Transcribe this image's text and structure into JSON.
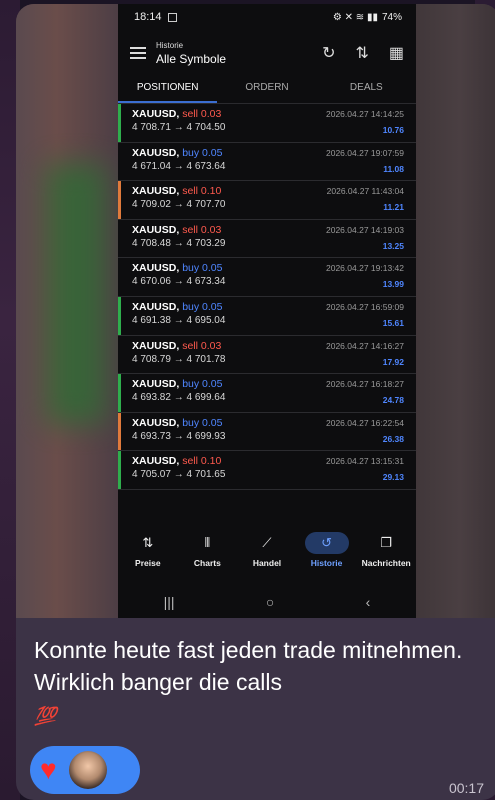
{
  "status": {
    "time": "18:14",
    "battery": "74%",
    "icons": "⚙ ✕ ≋ ▮▮"
  },
  "appbar": {
    "small_title": "Historie",
    "title": "Alle Symbole",
    "icon1": "↻",
    "icon2": "⇅",
    "icon3": "▦"
  },
  "tabs": [
    {
      "label": "POSITIONEN"
    },
    {
      "label": "ORDERN"
    },
    {
      "label": "DEALS"
    }
  ],
  "rows": [
    {
      "symbol": "XAUUSD,",
      "side": "sell 0.03",
      "side_type": "sell",
      "prices": "4 708.71 → 4 704.50",
      "time": "2026.04.27 14:14:25",
      "profit": "10.76",
      "bar_color": "#2fae4d"
    },
    {
      "symbol": "XAUUSD,",
      "side": "buy 0.05",
      "side_type": "buy",
      "prices": "4 671.04 → 4 673.64",
      "time": "2026.04.27 19:07:59",
      "profit": "11.08",
      "bar_color": ""
    },
    {
      "symbol": "XAUUSD,",
      "side": "sell 0.10",
      "side_type": "sell",
      "prices": "4 709.02 → 4 707.70",
      "time": "2026.04.27 11:43:04",
      "profit": "11.21",
      "bar_color": "#e07a3c"
    },
    {
      "symbol": "XAUUSD,",
      "side": "sell 0.03",
      "side_type": "sell",
      "prices": "4 708.48 → 4 703.29",
      "time": "2026.04.27 14:19:03",
      "profit": "13.25",
      "bar_color": ""
    },
    {
      "symbol": "XAUUSD,",
      "side": "buy 0.05",
      "side_type": "buy",
      "prices": "4 670.06 → 4 673.34",
      "time": "2026.04.27 19:13:42",
      "profit": "13.99",
      "bar_color": ""
    },
    {
      "symbol": "XAUUSD,",
      "side": "buy 0.05",
      "side_type": "buy",
      "prices": "4 691.38 → 4 695.04",
      "time": "2026.04.27 16:59:09",
      "profit": "15.61",
      "bar_color": "#2fae4d"
    },
    {
      "symbol": "XAUUSD,",
      "side": "sell 0.03",
      "side_type": "sell",
      "prices": "4 708.79 → 4 701.78",
      "time": "2026.04.27 14:16:27",
      "profit": "17.92",
      "bar_color": ""
    },
    {
      "symbol": "XAUUSD,",
      "side": "buy 0.05",
      "side_type": "buy",
      "prices": "4 693.82 → 4 699.64",
      "time": "2026.04.27 16:18:27",
      "profit": "24.78",
      "bar_color": "#2fae4d"
    },
    {
      "symbol": "XAUUSD,",
      "side": "buy 0.05",
      "side_type": "buy",
      "prices": "4 693.73 → 4 699.93",
      "time": "2026.04.27 16:22:54",
      "profit": "26.38",
      "bar_color": "#e07a3c"
    },
    {
      "symbol": "XAUUSD,",
      "side": "sell 0.10",
      "side_type": "sell",
      "prices": "4 705.07 → 4 701.65",
      "time": "2026.04.27 13:15:31",
      "profit": "29.13",
      "bar_color": "#2fae4d"
    }
  ],
  "nav": [
    {
      "label": "Preise",
      "icon": "⇅",
      "active": false
    },
    {
      "label": "Charts",
      "icon": "⫴",
      "active": false
    },
    {
      "label": "Handel",
      "icon": "⟋",
      "active": false
    },
    {
      "label": "Historie",
      "icon": "↺",
      "active": true
    },
    {
      "label": "Nachrichten",
      "icon": "❐",
      "active": false
    }
  ],
  "sysnav": {
    "recent": "|||",
    "home": "○",
    "back": "‹"
  },
  "message": {
    "text": "Konnte heute fast jeden trade mitnehmen. Wirklich banger die calls",
    "emoji": "💯"
  },
  "reaction": {
    "heart": "♥"
  },
  "timestamp": "00:17",
  "colors": {
    "buy": "#4f86ff",
    "sell": "#ff5a4e",
    "accent": "#3f86f5"
  }
}
